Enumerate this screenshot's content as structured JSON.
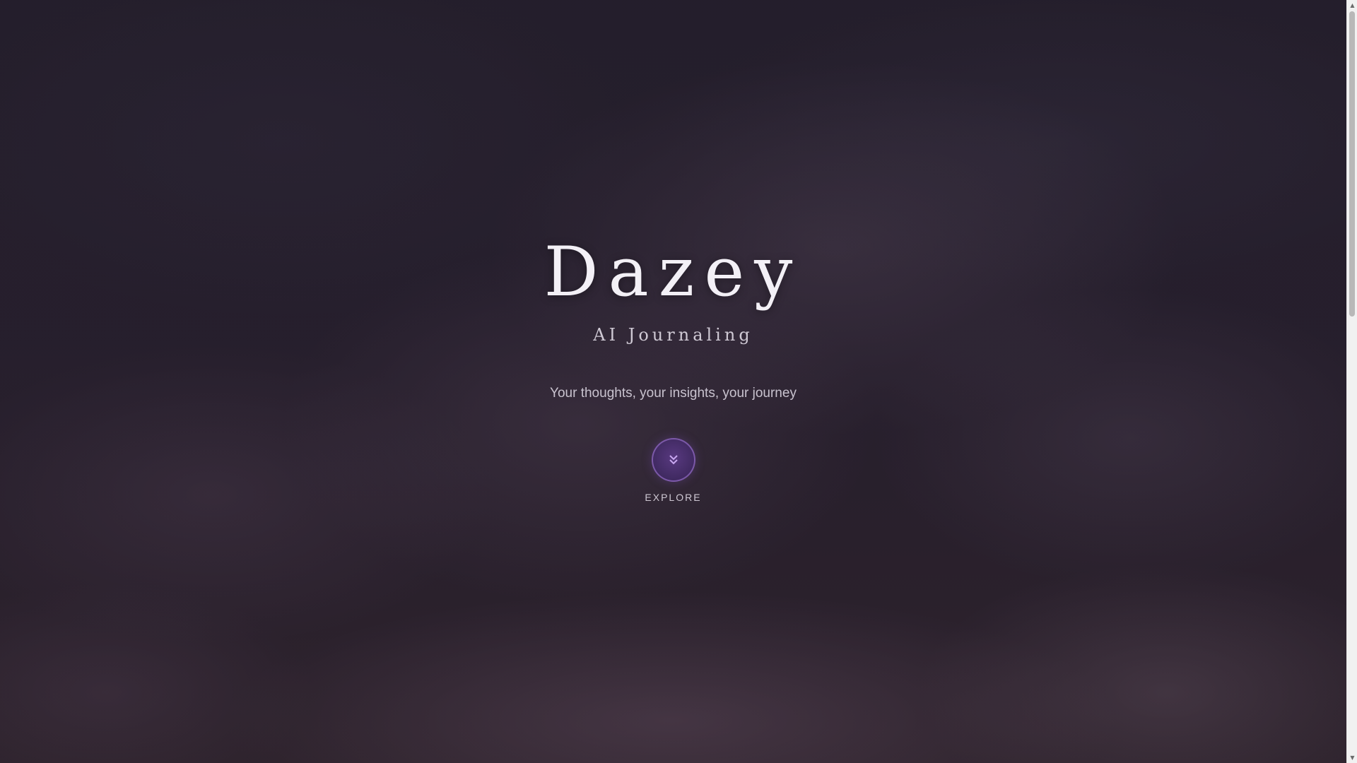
{
  "hero": {
    "title": "Dazey",
    "subtitle": "AI Journaling",
    "tagline": "Your thoughts, your insights, your journey"
  },
  "explore": {
    "label": "EXPLORE",
    "icon": "double-chevron-down-icon"
  },
  "scrollbar": {
    "up_icon": "▲",
    "down_icon": "▼",
    "position_fraction": 0.0
  },
  "colors": {
    "accent": "#6b45a8",
    "text": "#f3f0f6"
  }
}
